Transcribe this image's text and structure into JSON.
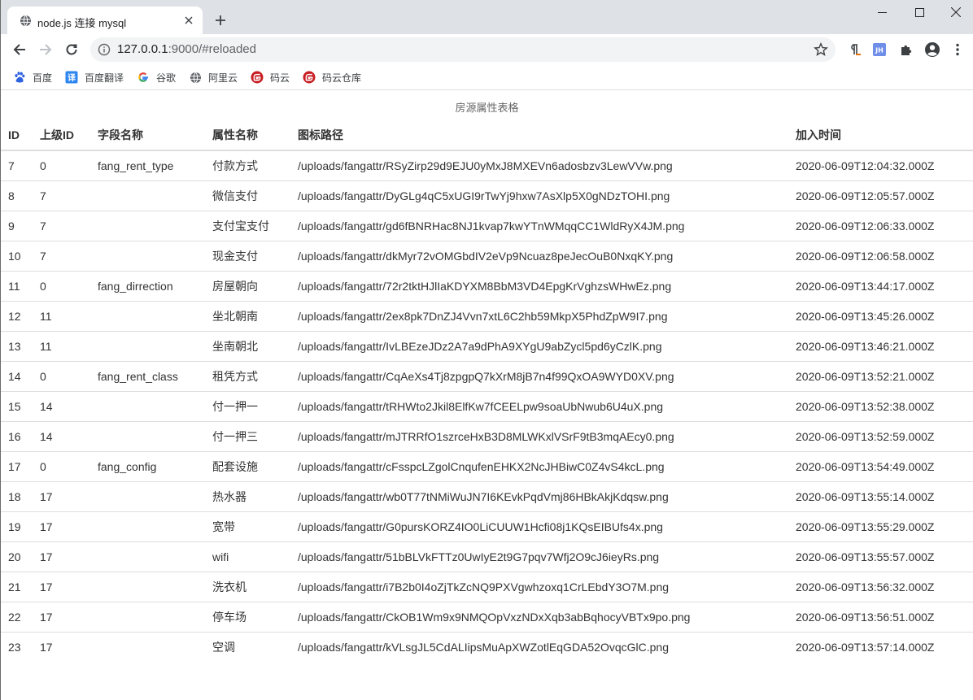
{
  "browser": {
    "tab_title": "node.js 连接 mysql",
    "url_host": "127.0.0.1",
    "url_rest": ":9000/#reloaded",
    "bookmarks": [
      "百度",
      "百度翻译",
      "谷歌",
      "阿里云",
      "码云",
      "码云仓库"
    ]
  },
  "page": {
    "caption": "房源属性表格",
    "columns": [
      "ID",
      "上级ID",
      "字段名称",
      "属性名称",
      "图标路径",
      "加入时间"
    ],
    "rows": [
      {
        "id": "7",
        "pid": "0",
        "field": "fang_rent_type",
        "name": "付款方式",
        "icon": "/uploads/fangattr/RSyZirp29d9EJU0yMxJ8MXEVn6adosbzv3LewVVw.png",
        "time": "2020-06-09T12:04:32.000Z"
      },
      {
        "id": "8",
        "pid": "7",
        "field": "",
        "name": "微信支付",
        "icon": "/uploads/fangattr/DyGLg4qC5xUGI9rTwYj9hxw7AsXlp5X0gNDzTOHI.png",
        "time": "2020-06-09T12:05:57.000Z"
      },
      {
        "id": "9",
        "pid": "7",
        "field": "",
        "name": "支付宝支付",
        "icon": "/uploads/fangattr/gd6fBNRHac8NJ1kvap7kwYTnWMqqCC1WldRyX4JM.png",
        "time": "2020-06-09T12:06:33.000Z"
      },
      {
        "id": "10",
        "pid": "7",
        "field": "",
        "name": "现金支付",
        "icon": "/uploads/fangattr/dkMyr72vOMGbdIV2eVp9Ncuaz8peJecOuB0NxqKY.png",
        "time": "2020-06-09T12:06:58.000Z"
      },
      {
        "id": "11",
        "pid": "0",
        "field": "fang_dirrection",
        "name": "房屋朝向",
        "icon": "/uploads/fangattr/72r2tktHJlIaKDYXM8BbM3VD4EpgKrVghzsWHwEz.png",
        "time": "2020-06-09T13:44:17.000Z"
      },
      {
        "id": "12",
        "pid": "11",
        "field": "",
        "name": "坐北朝南",
        "icon": "/uploads/fangattr/2ex8pk7DnZJ4Vvn7xtL6C2hb59MkpX5PhdZpW9I7.png",
        "time": "2020-06-09T13:45:26.000Z"
      },
      {
        "id": "13",
        "pid": "11",
        "field": "",
        "name": "坐南朝北",
        "icon": "/uploads/fangattr/IvLBEzeJDz2A7a9dPhA9XYgU9abZycl5pd6yCzlK.png",
        "time": "2020-06-09T13:46:21.000Z"
      },
      {
        "id": "14",
        "pid": "0",
        "field": "fang_rent_class",
        "name": "租凭方式",
        "icon": "/uploads/fangattr/CqAeXs4Tj8zpgpQ7kXrM8jB7n4f99QxOA9WYD0XV.png",
        "time": "2020-06-09T13:52:21.000Z"
      },
      {
        "id": "15",
        "pid": "14",
        "field": "",
        "name": "付一押一",
        "icon": "/uploads/fangattr/tRHWto2Jkil8ElfKw7fCEELpw9soaUbNwub6U4uX.png",
        "time": "2020-06-09T13:52:38.000Z"
      },
      {
        "id": "16",
        "pid": "14",
        "field": "",
        "name": "付一押三",
        "icon": "/uploads/fangattr/mJTRRfO1szrceHxB3D8MLWKxlVSrF9tB3mqAEcy0.png",
        "time": "2020-06-09T13:52:59.000Z"
      },
      {
        "id": "17",
        "pid": "0",
        "field": "fang_config",
        "name": "配套设施",
        "icon": "/uploads/fangattr/cFsspcLZgolCnqufenEHKX2NcJHBiwC0Z4vS4kcL.png",
        "time": "2020-06-09T13:54:49.000Z"
      },
      {
        "id": "18",
        "pid": "17",
        "field": "",
        "name": "热水器",
        "icon": "/uploads/fangattr/wb0T77tNMiWuJN7I6KEvkPqdVmj86HBkAkjKdqsw.png",
        "time": "2020-06-09T13:55:14.000Z"
      },
      {
        "id": "19",
        "pid": "17",
        "field": "",
        "name": "宽带",
        "icon": "/uploads/fangattr/G0pursKORZ4IO0LiCUUW1Hcfi08j1KQsEIBUfs4x.png",
        "time": "2020-06-09T13:55:29.000Z"
      },
      {
        "id": "20",
        "pid": "17",
        "field": "",
        "name": "wifi",
        "icon": "/uploads/fangattr/51bBLVkFTTz0UwIyE2t9G7pqv7Wfj2O9cJ6ieyRs.png",
        "time": "2020-06-09T13:55:57.000Z"
      },
      {
        "id": "21",
        "pid": "17",
        "field": "",
        "name": "洗衣机",
        "icon": "/uploads/fangattr/i7B2b0I4oZjTkZcNQ9PXVgwhzoxq1CrLEbdY3O7M.png",
        "time": "2020-06-09T13:56:32.000Z"
      },
      {
        "id": "22",
        "pid": "17",
        "field": "",
        "name": "停车场",
        "icon": "/uploads/fangattr/CkOB1Wm9x9NMQOpVxzNDxXqb3abBqhocyVBTx9po.png",
        "time": "2020-06-09T13:56:51.000Z"
      },
      {
        "id": "23",
        "pid": "17",
        "field": "",
        "name": "空调",
        "icon": "/uploads/fangattr/kVLsgJL5CdALIipsMuApXWZotlEqGDA52OvqcGlC.png",
        "time": "2020-06-09T13:57:14.000Z"
      }
    ]
  }
}
